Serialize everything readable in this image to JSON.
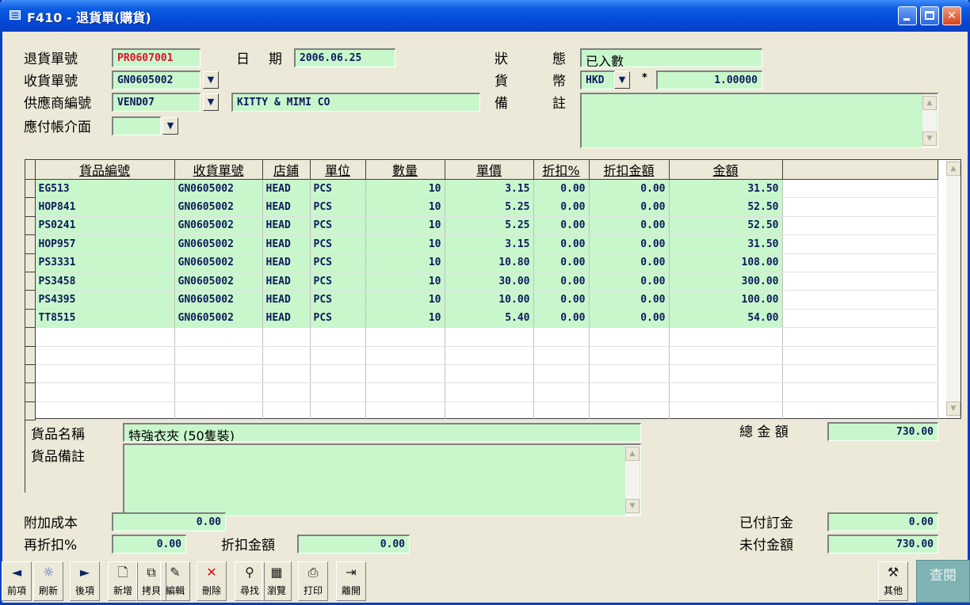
{
  "window": {
    "title": "F410 - 退貨單(購貨)",
    "controls": {
      "minimize": "minimize-icon",
      "maximize": "maximize-icon",
      "close": "close-icon"
    }
  },
  "header": {
    "return_no_label": "退貨單號",
    "return_no": "PR0607001",
    "date_label_1": "日",
    "date_label_2": "期",
    "date": "2006.06.25",
    "status_label_1": "狀",
    "status_label_2": "態",
    "status": "已入數",
    "receipt_no_label": "收貨單號",
    "receipt_no": "GN0605002",
    "currency_label_1": "貨",
    "currency_label_2": "幣",
    "currency": "HKD",
    "rate_sep": "*",
    "rate": "1.00000",
    "supplier_label": "供應商編號",
    "supplier_code": "VEND07",
    "supplier_name": "KITTY & MIMI CO",
    "remark_label_1": "備",
    "remark_label_2": "註",
    "remark": "",
    "payable_label": "應付帳介面",
    "payable": ""
  },
  "grid": {
    "columns": [
      "貨品編號",
      "收貨單號",
      "店鋪",
      "單位",
      "數量",
      "單價",
      "折扣%",
      "折扣金額",
      "金額"
    ],
    "rows": [
      [
        "EG513",
        "GN0605002",
        "HEAD",
        "PCS",
        "10",
        "3.15",
        "0.00",
        "0.00",
        "31.50"
      ],
      [
        "HOP841",
        "GN0605002",
        "HEAD",
        "PCS",
        "10",
        "5.25",
        "0.00",
        "0.00",
        "52.50"
      ],
      [
        "PS0241",
        "GN0605002",
        "HEAD",
        "PCS",
        "10",
        "5.25",
        "0.00",
        "0.00",
        "52.50"
      ],
      [
        "HOP957",
        "GN0605002",
        "HEAD",
        "PCS",
        "10",
        "3.15",
        "0.00",
        "0.00",
        "31.50"
      ],
      [
        "PS3331",
        "GN0605002",
        "HEAD",
        "PCS",
        "10",
        "10.80",
        "0.00",
        "0.00",
        "108.00"
      ],
      [
        "PS3458",
        "GN0605002",
        "HEAD",
        "PCS",
        "10",
        "30.00",
        "0.00",
        "0.00",
        "300.00"
      ],
      [
        "PS4395",
        "GN0605002",
        "HEAD",
        "PCS",
        "10",
        "10.00",
        "0.00",
        "0.00",
        "100.00"
      ],
      [
        "TT8515",
        "GN0605002",
        "HEAD",
        "PCS",
        "10",
        "5.40",
        "0.00",
        "0.00",
        "54.00"
      ]
    ],
    "empty_rows": 5
  },
  "detail": {
    "name_label": "貨品名稱",
    "name": "特強衣夾 (50隻裝)",
    "note_label": "貨品備註",
    "note": "",
    "total_label": "總 金 額",
    "total": "730.00"
  },
  "footer": {
    "extra_cost_label": "附加成本",
    "extra_cost": "0.00",
    "rediscount_label": "再折扣%",
    "rediscount": "0.00",
    "discount_amount_label": "折扣金額",
    "discount_amount": "0.00",
    "deposit_label": "已付訂金",
    "deposit": "0.00",
    "unpaid_label": "未付金額",
    "unpaid": "730.00"
  },
  "toolbar": {
    "buttons": [
      {
        "label": "前項",
        "icon": "◄"
      },
      {
        "label": "刷新",
        "icon": "☼"
      },
      {
        "label": "後項",
        "icon": "►"
      },
      {
        "label": "新增",
        "icon": "🗋"
      },
      {
        "label": "拷貝",
        "icon": "⧉"
      },
      {
        "label": "編輯",
        "icon": "✎"
      },
      {
        "label": "刪除",
        "icon": "✕"
      },
      {
        "label": "尋找",
        "icon": "⚲"
      },
      {
        "label": "瀏覽",
        "icon": "▦"
      },
      {
        "label": "打印",
        "icon": "⎙"
      },
      {
        "label": "離開",
        "icon": "⇥"
      }
    ],
    "other": {
      "label": "其他",
      "icon": "⚒"
    },
    "view_label": "查閱"
  },
  "colors": {
    "field_bg": "#c8f7cc",
    "title_bar": "#0549d6",
    "id_red": "#e0102a",
    "view_btn": "#7fb2b3"
  }
}
